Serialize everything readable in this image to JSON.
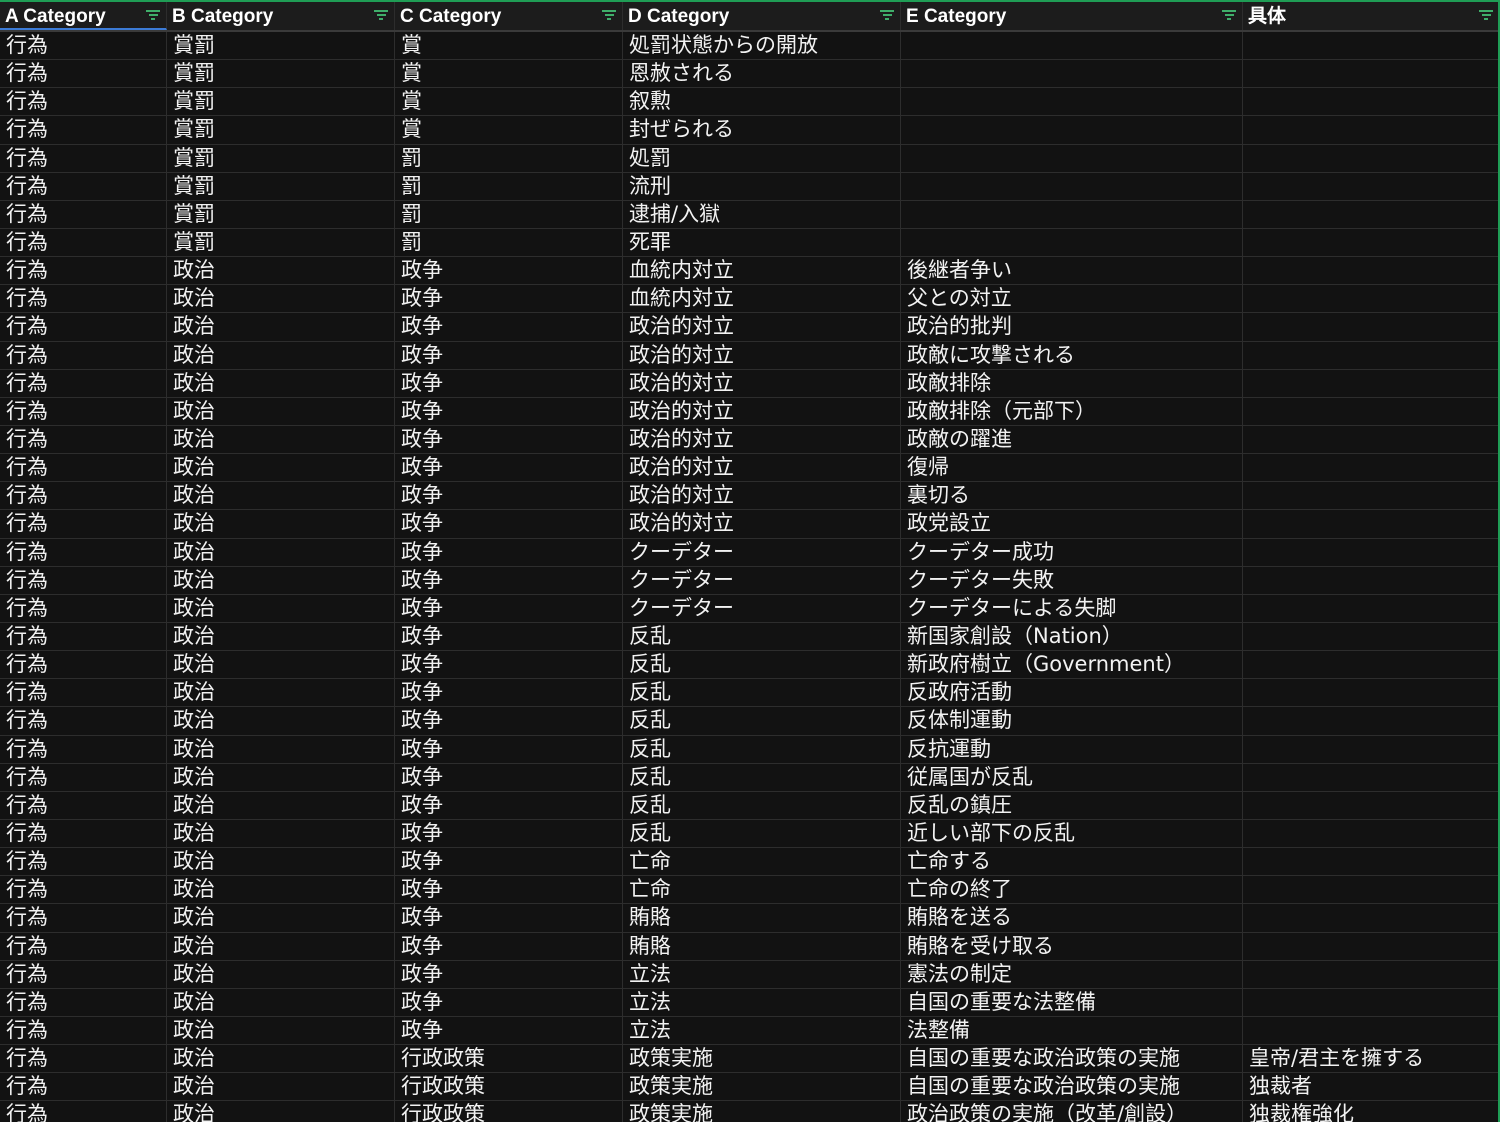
{
  "headers": [
    "A Category",
    "B Category",
    "C Category",
    "D Category",
    "E Category",
    "具体"
  ],
  "rows": [
    [
      "行為",
      "賞罰",
      "賞",
      "処罰状態からの開放",
      "",
      ""
    ],
    [
      "行為",
      "賞罰",
      "賞",
      "恩赦される",
      "",
      ""
    ],
    [
      "行為",
      "賞罰",
      "賞",
      "叙勲",
      "",
      ""
    ],
    [
      "行為",
      "賞罰",
      "賞",
      "封ぜられる",
      "",
      ""
    ],
    [
      "行為",
      "賞罰",
      "罰",
      "処罰",
      "",
      ""
    ],
    [
      "行為",
      "賞罰",
      "罰",
      "流刑",
      "",
      ""
    ],
    [
      "行為",
      "賞罰",
      "罰",
      "逮捕/入獄",
      "",
      ""
    ],
    [
      "行為",
      "賞罰",
      "罰",
      "死罪",
      "",
      ""
    ],
    [
      "行為",
      "政治",
      "政争",
      "血統内対立",
      "後継者争い",
      ""
    ],
    [
      "行為",
      "政治",
      "政争",
      "血統内対立",
      "父との対立",
      ""
    ],
    [
      "行為",
      "政治",
      "政争",
      "政治的対立",
      "政治的批判",
      ""
    ],
    [
      "行為",
      "政治",
      "政争",
      "政治的対立",
      "政敵に攻撃される",
      ""
    ],
    [
      "行為",
      "政治",
      "政争",
      "政治的対立",
      "政敵排除",
      ""
    ],
    [
      "行為",
      "政治",
      "政争",
      "政治的対立",
      "政敵排除（元部下）",
      ""
    ],
    [
      "行為",
      "政治",
      "政争",
      "政治的対立",
      "政敵の躍進",
      ""
    ],
    [
      "行為",
      "政治",
      "政争",
      "政治的対立",
      "復帰",
      ""
    ],
    [
      "行為",
      "政治",
      "政争",
      "政治的対立",
      "裏切る",
      ""
    ],
    [
      "行為",
      "政治",
      "政争",
      "政治的対立",
      "政党設立",
      ""
    ],
    [
      "行為",
      "政治",
      "政争",
      "クーデター",
      "クーデター成功",
      ""
    ],
    [
      "行為",
      "政治",
      "政争",
      "クーデター",
      "クーデター失敗",
      ""
    ],
    [
      "行為",
      "政治",
      "政争",
      "クーデター",
      "クーデターによる失脚",
      ""
    ],
    [
      "行為",
      "政治",
      "政争",
      "反乱",
      "新国家創設（Nation）",
      ""
    ],
    [
      "行為",
      "政治",
      "政争",
      "反乱",
      "新政府樹立（Government）",
      ""
    ],
    [
      "行為",
      "政治",
      "政争",
      "反乱",
      "反政府活動",
      ""
    ],
    [
      "行為",
      "政治",
      "政争",
      "反乱",
      "反体制運動",
      ""
    ],
    [
      "行為",
      "政治",
      "政争",
      "反乱",
      "反抗運動",
      ""
    ],
    [
      "行為",
      "政治",
      "政争",
      "反乱",
      "従属国が反乱",
      ""
    ],
    [
      "行為",
      "政治",
      "政争",
      "反乱",
      "反乱の鎮圧",
      ""
    ],
    [
      "行為",
      "政治",
      "政争",
      "反乱",
      "近しい部下の反乱",
      ""
    ],
    [
      "行為",
      "政治",
      "政争",
      "亡命",
      "亡命する",
      ""
    ],
    [
      "行為",
      "政治",
      "政争",
      "亡命",
      "亡命の終了",
      ""
    ],
    [
      "行為",
      "政治",
      "政争",
      "賄賂",
      "賄賂を送る",
      ""
    ],
    [
      "行為",
      "政治",
      "政争",
      "賄賂",
      "賄賂を受け取る",
      ""
    ],
    [
      "行為",
      "政治",
      "政争",
      "立法",
      "憲法の制定",
      ""
    ],
    [
      "行為",
      "政治",
      "政争",
      "立法",
      "自国の重要な法整備",
      ""
    ],
    [
      "行為",
      "政治",
      "政争",
      "立法",
      "法整備",
      ""
    ],
    [
      "行為",
      "政治",
      "行政政策",
      "政策実施",
      "自国の重要な政治政策の実施",
      "皇帝/君主を擁する"
    ],
    [
      "行為",
      "政治",
      "行政政策",
      "政策実施",
      "自国の重要な政治政策の実施",
      "独裁者"
    ],
    [
      "行為",
      "政治",
      "行政政策",
      "政策実施",
      "政治政策の実施（改革/創設）",
      "独裁権強化"
    ]
  ]
}
